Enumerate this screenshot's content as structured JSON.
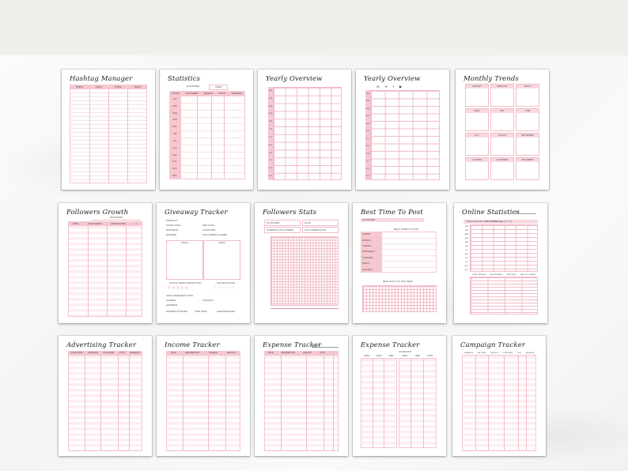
{
  "pages": {
    "hashtag_manager": {
      "title": "Hashtag Manager",
      "cols": [
        "TOPIC",
        "TOPIC",
        "TOPIC",
        "TOPIC"
      ]
    },
    "statistics": {
      "title": "Statistics",
      "platform": "PLATFORM",
      "year": "YEAR",
      "cols": [
        "MONTH",
        "FOLLOWERS",
        "GROWTH",
        "POSTS",
        "TOP MEDIA"
      ],
      "months": [
        "JAN",
        "FEB",
        "MAR",
        "APR",
        "MAY",
        "JUN",
        "JUL",
        "AUG",
        "SEP",
        "OCT",
        "NOV",
        "DEC"
      ]
    },
    "yearly_overview_1": {
      "title": "Yearly Overview",
      "months": [
        "JAN",
        "FEB",
        "MAR",
        "APR",
        "MAY",
        "JUN",
        "JUL",
        "AUG",
        "SEP",
        "OCT",
        "NOV",
        "DEC"
      ]
    },
    "yearly_overview_2": {
      "title": "Yearly Overview",
      "months": [
        "JAN",
        "FEB",
        "MAR",
        "APR",
        "MAY",
        "JUN",
        "JUL",
        "AUG",
        "SEP",
        "OCT",
        "NOV",
        "DEC"
      ]
    },
    "monthly_trends": {
      "title": "Monthly Trends",
      "months": [
        "JANUARY",
        "FEBRUARY",
        "MARCH",
        "APRIL",
        "MAY",
        "JUNE",
        "JULY",
        "AUGUST",
        "SEPTEMBER",
        "OCTOBER",
        "NOVEMBER",
        "DECEMBER"
      ]
    },
    "followers_growth": {
      "title": "Followers Growth",
      "platform": "PLATFORM",
      "cols": [
        "DATE",
        "FOLLOWING",
        "UNFOLLOWS",
        "+/-"
      ]
    },
    "giveaway_tracker": {
      "title": "Giveaway Tracker",
      "fields": [
        "PRODUCT",
        "START DATE",
        "END DATE",
        "SPONSOR",
        "PLATFORM",
        "EXPIRED",
        "FOLLOWERS GAINED"
      ],
      "rules": "RULES",
      "notes": "NOTES",
      "promotion": "SOCIAL MEDIA PROMOTION",
      "success": "SUCCESS RATE",
      "announce": "ANNOUNCEMENT DATE",
      "winner": "WINNER",
      "contact": "CONTACT",
      "address": "ADDRESS",
      "notified": "WINNER NOTIFIED",
      "sent": "ITEM SENT",
      "received": "ITEM RECEIVED"
    },
    "followers_stats": {
      "title": "Followers Stats",
      "platform": "PLATFORM",
      "date": "DATE",
      "current": "CURRENT FOLLOWERS",
      "goal": "FOLLOWERS GOAL"
    },
    "best_time": {
      "title": "Best Time To Post",
      "platform": "PLATFORM",
      "times": "BEST TIMES TO POST",
      "days": [
        "SUNDAY",
        "MONDAY",
        "TUESDAY",
        "WEDNESDAY",
        "THURSDAY",
        "FRIDAY",
        "SATURDAY"
      ],
      "best_days": "BEST DAYS OF THE WEEK"
    },
    "online_statistics": {
      "title": "Online Statistics",
      "year": "YEAR",
      "total": "TOTAL SOCIAL SUBSCRIBERS",
      "months": [
        "JAN",
        "FEB",
        "MAR",
        "APR",
        "MAY",
        "JUN",
        "JUL",
        "AUG",
        "SEP",
        "OCT",
        "NOV",
        "DEC"
      ],
      "cols": [
        "TOTAL VIEWERS",
        "NEW VIEWERS",
        "NEW LIKES",
        "NEW FOLLOWERS"
      ]
    },
    "advertising_tracker": {
      "title": "Advertising Tracker",
      "cols": [
        "START DATE",
        "END DATE",
        "PLATFORM",
        "COST",
        "REVENUE"
      ]
    },
    "income_tracker": {
      "title": "Income Tracker",
      "cols": [
        "DATE",
        "DESCRIPTION",
        "SOURCE",
        "AMOUNT"
      ]
    },
    "expense_tracker_1": {
      "title": "Expense Tracker",
      "month": "MONTH",
      "cols": [
        "DATE",
        "DESCRIPTION",
        "AMOUNT",
        "COST",
        "✓"
      ]
    },
    "expense_tracker_2": {
      "title": "Expense Tracker",
      "category": "CATEGORY",
      "cols": [
        "DATE",
        "COST",
        "ITEM",
        "DATE",
        "ITEM",
        "COST"
      ]
    },
    "campaign_tracker": {
      "title": "Campaign Tracker",
      "cols": [
        "CAMPAIGN",
        "END DATE",
        "PRODUCT",
        "PLATFORM",
        "COST",
        "REVENUE"
      ]
    }
  }
}
